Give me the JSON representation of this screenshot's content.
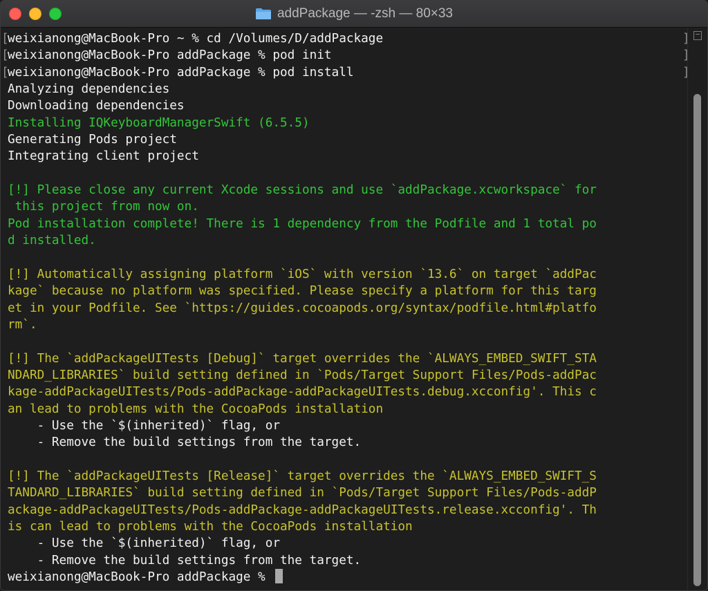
{
  "window": {
    "title": "addPackage — -zsh — 80×33"
  },
  "terminal": {
    "lines": [
      {
        "text": "weixianong@MacBook-Pro ~ % cd /Volumes/D/addPackage",
        "color": "white",
        "marked": true
      },
      {
        "text": "weixianong@MacBook-Pro addPackage % pod init",
        "color": "white",
        "marked": true
      },
      {
        "text": "weixianong@MacBook-Pro addPackage % pod install",
        "color": "white",
        "marked": true
      },
      {
        "text": "Analyzing dependencies",
        "color": "white"
      },
      {
        "text": "Downloading dependencies",
        "color": "white"
      },
      {
        "text": "Installing IQKeyboardManagerSwift (6.5.5)",
        "color": "green"
      },
      {
        "text": "Generating Pods project",
        "color": "white"
      },
      {
        "text": "Integrating client project",
        "color": "white"
      },
      {
        "text": "",
        "color": "white"
      },
      {
        "text": "[!] Please close any current Xcode sessions and use `addPackage.xcworkspace` for",
        "color": "green"
      },
      {
        "text": " this project from now on.",
        "color": "green"
      },
      {
        "text": "Pod installation complete! There is 1 dependency from the Podfile and 1 total po",
        "color": "green"
      },
      {
        "text": "d installed.",
        "color": "green"
      },
      {
        "text": "",
        "color": "white"
      },
      {
        "text": "[!] Automatically assigning platform `iOS` with version `13.6` on target `addPac",
        "color": "yellow"
      },
      {
        "text": "kage` because no platform was specified. Please specify a platform for this targ",
        "color": "yellow"
      },
      {
        "text": "et in your Podfile. See `https://guides.cocoapods.org/syntax/podfile.html#platfo",
        "color": "yellow"
      },
      {
        "text": "rm`.",
        "color": "yellow"
      },
      {
        "text": "",
        "color": "white"
      },
      {
        "text": "[!] The `addPackageUITests [Debug]` target overrides the `ALWAYS_EMBED_SWIFT_STA",
        "color": "yellow"
      },
      {
        "text": "NDARD_LIBRARIES` build setting defined in `Pods/Target Support Files/Pods-addPac",
        "color": "yellow"
      },
      {
        "text": "kage-addPackageUITests/Pods-addPackage-addPackageUITests.debug.xcconfig'. This c",
        "color": "yellow"
      },
      {
        "text": "an lead to problems with the CocoaPods installation",
        "color": "yellow"
      },
      {
        "text": "    - Use the `$(inherited)` flag, or",
        "color": "white"
      },
      {
        "text": "    - Remove the build settings from the target.",
        "color": "white"
      },
      {
        "text": "",
        "color": "white"
      },
      {
        "text": "[!] The `addPackageUITests [Release]` target overrides the `ALWAYS_EMBED_SWIFT_S",
        "color": "yellow"
      },
      {
        "text": "TANDARD_LIBRARIES` build setting defined in `Pods/Target Support Files/Pods-addP",
        "color": "yellow"
      },
      {
        "text": "ackage-addPackageUITests/Pods-addPackage-addPackageUITests.release.xcconfig'. Th",
        "color": "yellow"
      },
      {
        "text": "is can lead to problems with the CocoaPods installation",
        "color": "yellow"
      },
      {
        "text": "    - Use the `$(inherited)` flag, or",
        "color": "white"
      },
      {
        "text": "    - Remove the build settings from the target.",
        "color": "white"
      },
      {
        "text": "weixianong@MacBook-Pro addPackage % ",
        "color": "white",
        "cursor": true
      }
    ]
  },
  "icons": {
    "folder": "folder-icon"
  },
  "colors": {
    "green": "#33c53a",
    "yellow": "#c8c32d",
    "white": "#f2f2f2",
    "background": "#1e1e1e"
  }
}
